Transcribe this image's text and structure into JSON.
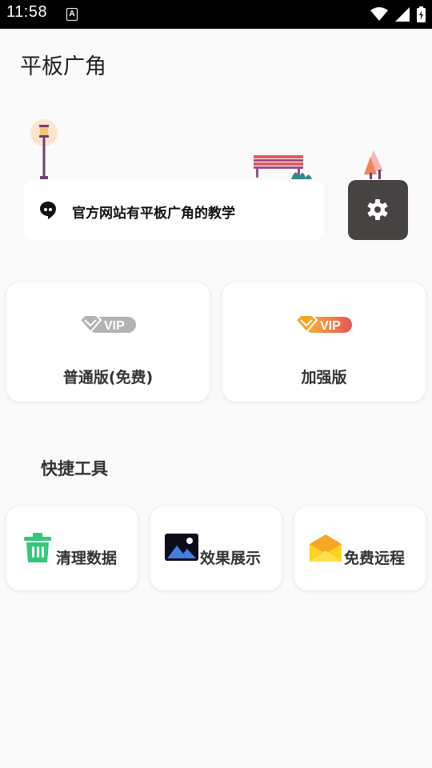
{
  "status_bar": {
    "time": "11:58",
    "notification_icon": "A"
  },
  "app": {
    "title": "平板广角"
  },
  "notice": {
    "text": "官方网站有平板广角的教学"
  },
  "versions": [
    {
      "badge": "VIP",
      "label": "普通版(免费)",
      "badge_color": "#a6a6a6"
    },
    {
      "badge": "VIP",
      "label": "加强版",
      "badge_color": "#f0a020"
    }
  ],
  "tools_section": {
    "title": "快捷工具",
    "items": [
      {
        "label": "清理数据",
        "icon": "trash-icon"
      },
      {
        "label": "效果展示",
        "icon": "image-icon"
      },
      {
        "label": "免费远程",
        "icon": "mail-icon"
      }
    ]
  },
  "colors": {
    "settings_bg": "#474342",
    "trash_green": "#34c77b",
    "image_dark": "#0d0d1a",
    "mail_yellow": "#ffd21f"
  }
}
